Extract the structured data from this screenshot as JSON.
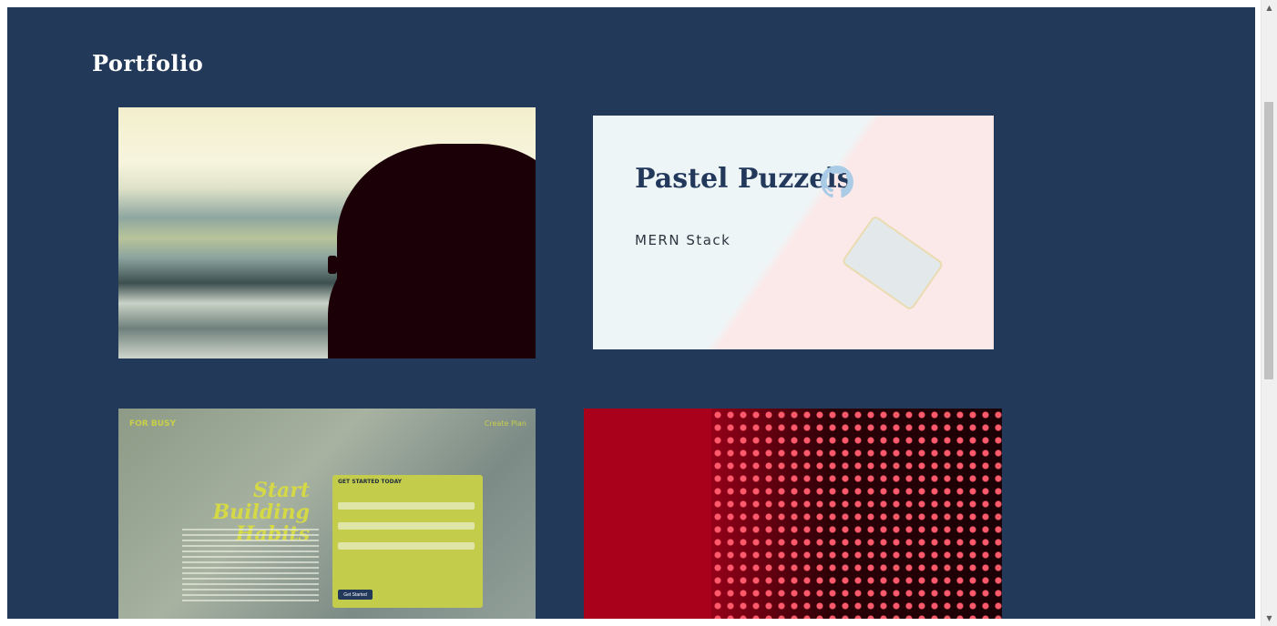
{
  "page": {
    "title": "Portfolio"
  },
  "cards": [
    {
      "image": "surf-silhouette-photo"
    },
    {
      "title": "Pastel Puzzels",
      "subtitle": "MERN Stack",
      "icon": "github-icon"
    },
    {
      "image": "habits-app-screenshot",
      "brand": "FOR BUSY",
      "nav": "Create Plan",
      "headline": "Start Building Habits",
      "form_heading": "GET STARTED TODAY",
      "button_label": "Get Started"
    },
    {
      "image": "red-led-grid-photo"
    }
  ],
  "scrollbar": {
    "up_icon": "▲",
    "down_icon": "▼"
  },
  "colors": {
    "background": "#22395a",
    "title_text": "#ffffff",
    "project_title": "#23395c"
  }
}
